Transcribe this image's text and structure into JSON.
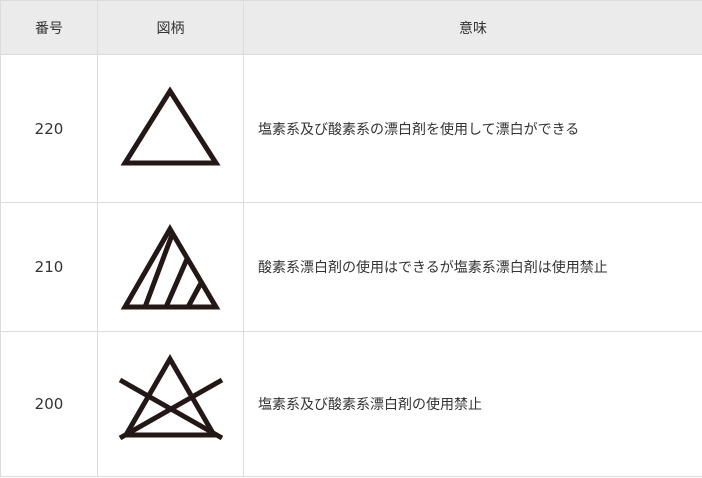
{
  "table": {
    "headers": {
      "number": "番号",
      "symbol": "図柄",
      "meaning": "意味"
    },
    "rows": [
      {
        "number": "220",
        "symbol_icon": "triangle-icon",
        "meaning": "塩素系及び酸素系の漂白剤を使用して漂白ができる"
      },
      {
        "number": "210",
        "symbol_icon": "triangle-diagonal-lines-icon",
        "meaning": "酸素系漂白剤の使用はできるが塩素系漂白剤は使用禁止"
      },
      {
        "number": "200",
        "symbol_icon": "crossed-triangle-icon",
        "meaning": "塩素系及び酸素系漂白剤の使用禁止"
      }
    ]
  },
  "colors": {
    "header_background": "#ebebeb",
    "border": "#dcdcdc",
    "symbol_stroke": "#231815",
    "text": "#333333"
  }
}
